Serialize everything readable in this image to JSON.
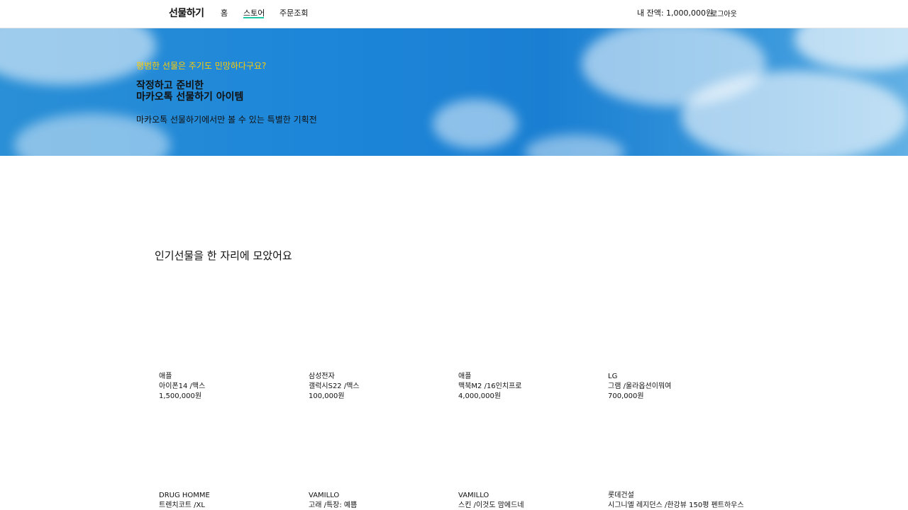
{
  "header": {
    "brand": "선물하기",
    "nav": [
      "홈",
      "스토어",
      "주문조회"
    ],
    "balance": "내 잔액: 1,000,000원",
    "logout": "로그아웃",
    "accent_color": "#1fc7a4"
  },
  "hero": {
    "eyebrow": "평범한 선물은 주기도 민망하다구요?",
    "title_line1": "작정하고 준비한",
    "title_line2": "마카오톡 선물하기 아이템",
    "subtitle": "마카오톡 선물하기에서만 볼 수 있는 특별한 기획전",
    "eyebrow_color": "#ffcc00"
  },
  "section": {
    "title": "인기선물을 한 자리에 모았어요"
  },
  "products": [
    {
      "brand": "애플",
      "name": "아이폰14 /맥스",
      "price": "1,500,000원"
    },
    {
      "brand": "삼성전자",
      "name": "갤럭시S22 /맥스",
      "price": "100,000원"
    },
    {
      "brand": "애플",
      "name": "맥북M2 /16인치프로",
      "price": "4,000,000원"
    },
    {
      "brand": "LG",
      "name": "그램 /울라옵션이뭐여",
      "price": "700,000원"
    },
    {
      "brand": "DRUG HOMME",
      "name": "트렌치코트 /XL",
      "price": ""
    },
    {
      "brand": "VAMILLO",
      "name": "고래 /특장: 예쁨",
      "price": ""
    },
    {
      "brand": "VAMILLO",
      "name": "스킨 /이것도 맘에드네",
      "price": ""
    },
    {
      "brand": "롯데건설",
      "name": "시그니엘 레지던스 /한강뷰 150평 펜트하우스",
      "price": ""
    }
  ]
}
